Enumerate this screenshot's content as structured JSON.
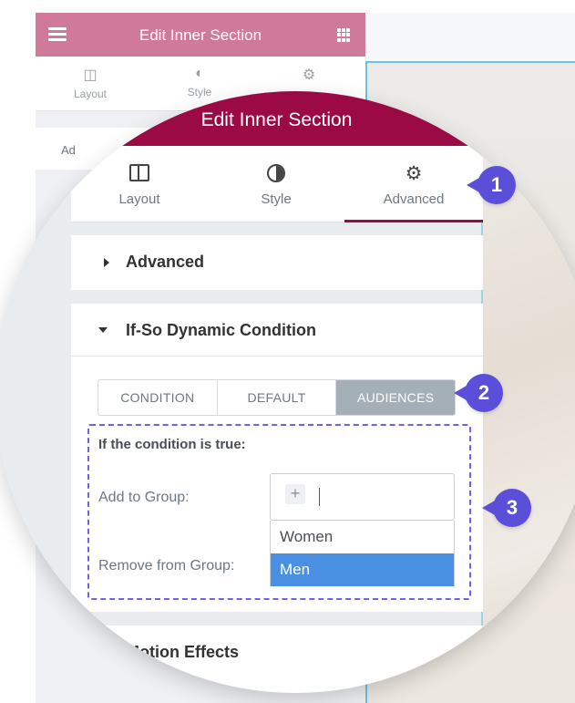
{
  "background": {
    "header_title": "Edit Inner Section",
    "tabs": [
      "Layout",
      "Style",
      ""
    ],
    "accordion_label": "Ad"
  },
  "panel": {
    "title": "Edit Inner Section",
    "tabs": [
      {
        "label": "Layout",
        "icon": "layout-icon"
      },
      {
        "label": "Style",
        "icon": "style-icon"
      },
      {
        "label": "Advanced",
        "icon": "gear-icon",
        "active": true
      }
    ],
    "sections": {
      "advanced": "Advanced",
      "dynamic": "If-So Dynamic Condition",
      "motion": "Motion Effects"
    },
    "segments": [
      "CONDITION",
      "DEFAULT",
      "AUDIENCES"
    ],
    "active_segment": "AUDIENCES",
    "condition_label": "If the condition is true:",
    "add_group_label": "Add to Group:",
    "remove_group_label": "Remove from Group:",
    "add_button": "+",
    "options": [
      "Women",
      "Men"
    ],
    "selected_option": "Men"
  },
  "callouts": [
    "1",
    "2",
    "3"
  ],
  "colors": {
    "header_bg": "#9b0a44",
    "background_header": "#d07a9a",
    "callout": "#5b4fd9",
    "selection": "#4a90e2",
    "dashed_border": "#6c63e8"
  }
}
